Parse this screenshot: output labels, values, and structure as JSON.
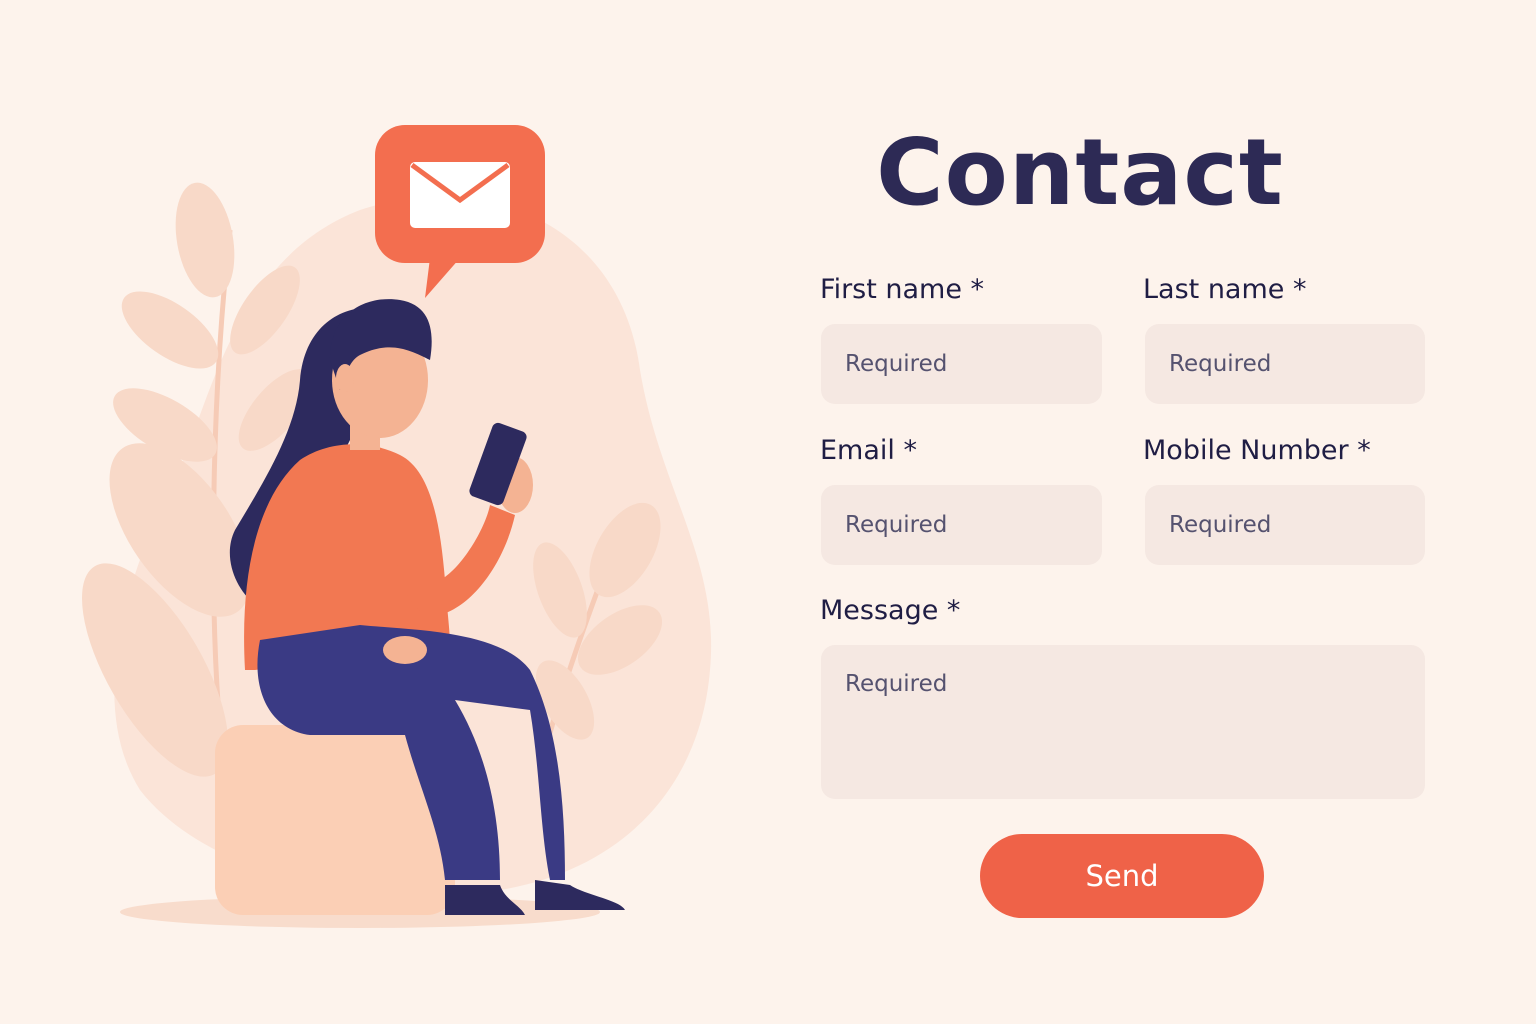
{
  "form": {
    "title": "Contact",
    "fields": {
      "first_name": {
        "label": "First name *",
        "placeholder": "Required"
      },
      "last_name": {
        "label": "Last name *",
        "placeholder": "Required"
      },
      "email": {
        "label": "Email *",
        "placeholder": "Required"
      },
      "mobile": {
        "label": "Mobile Number *",
        "placeholder": "Required"
      },
      "message": {
        "label": "Message *",
        "placeholder": "Required"
      }
    },
    "submit_label": "Send"
  },
  "illustration": {
    "icons": [
      "envelope-icon",
      "chat-bubble-icon",
      "phone-icon",
      "leaf-icon"
    ]
  },
  "colors": {
    "background": "#fdf3ec",
    "accent": "#ef6248",
    "heading": "#2d2a55",
    "field_background": "#f5e8e2"
  }
}
